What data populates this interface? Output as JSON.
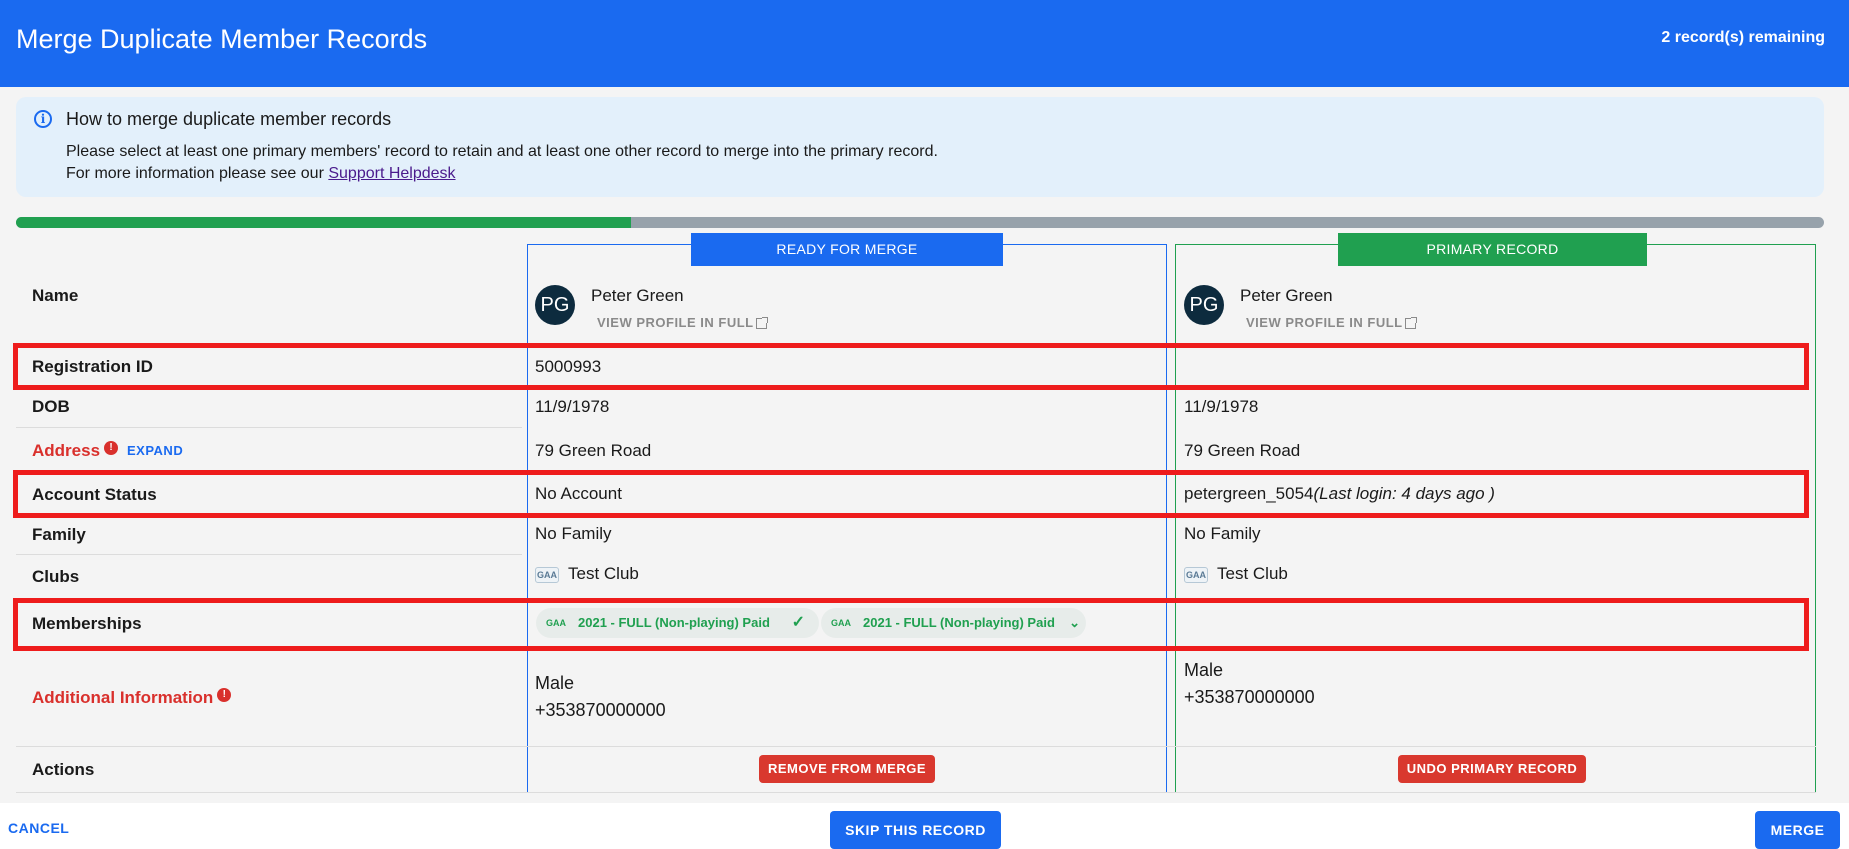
{
  "header": {
    "title": "Merge Duplicate Member Records",
    "remaining": "2 record(s) remaining"
  },
  "info": {
    "icon": "info-icon",
    "title": "How to merge duplicate member records",
    "line1": "Please select at least one primary members' record to retain and at least one other record to merge into the primary record.",
    "line2_prefix": "For more information please see our ",
    "link_text": "Support Helpdesk"
  },
  "progress": {
    "fraction": 0.34,
    "fill_color": "#20a050",
    "track_color": "#97a2ab"
  },
  "columns": {
    "merge_tag": "READY FOR MERGE",
    "primary_tag": "PRIMARY RECORD"
  },
  "labels": {
    "name": "Name",
    "registration_id": "Registration ID",
    "dob": "DOB",
    "address": "Address",
    "address_expand": "EXPAND",
    "account_status": "Account Status",
    "family": "Family",
    "clubs": "Clubs",
    "memberships": "Memberships",
    "additional_information": "Additional Information",
    "actions": "Actions"
  },
  "merge_record": {
    "initials": "PG",
    "name": "Peter Green",
    "view_profile": "VIEW PROFILE IN FULL",
    "registration_id": "5000993",
    "dob": "11/9/1978",
    "address": "79 Green Road",
    "account_status": "No Account",
    "family": "No Family",
    "club": "Test Club",
    "memberships": [
      "2021 - FULL (Non-playing) Paid",
      "2021 - FULL (Non-playing) Paid"
    ],
    "gender": "Male",
    "phone": "+353870000000",
    "action": "REMOVE FROM MERGE"
  },
  "primary_record": {
    "initials": "PG",
    "name": "Peter Green",
    "view_profile": "VIEW PROFILE IN FULL",
    "registration_id": "",
    "dob": "11/9/1978",
    "address": "79 Green Road",
    "account_username": "petergreen_5054",
    "account_last_login": "(Last login: 4 days ago )",
    "family": "No Family",
    "club": "Test Club",
    "gender": "Male",
    "phone": "+353870000000",
    "action": "UNDO PRIMARY RECORD"
  },
  "club_logo_text": "GAA",
  "footer": {
    "cancel": "CANCEL",
    "skip": "SKIP THIS RECORD",
    "merge": "MERGE"
  },
  "colors": {
    "header_blue": "#1a6af0",
    "primary_green": "#20a050",
    "danger_red": "#d9382e",
    "highlight_red": "#ee1c1c"
  }
}
